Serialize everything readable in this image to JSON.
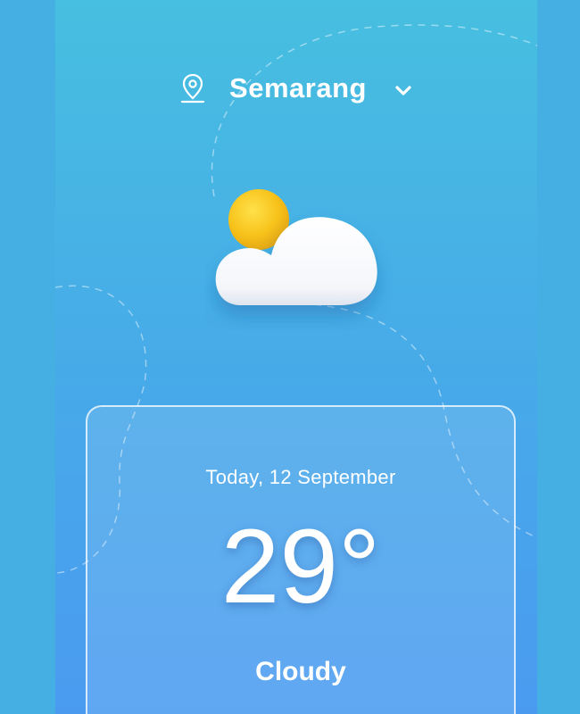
{
  "location": {
    "city": "Semarang"
  },
  "weather": {
    "icon": "sun-behind-cloud-icon",
    "date": "Today, 12 September",
    "temperature": "29°",
    "condition": "Cloudy"
  },
  "colors": {
    "background_top": "#47bfe0",
    "background_bottom": "#4a9bf0",
    "outer_background": "#45aee3",
    "sun": "#f7c21a",
    "cloud": "#ffffff",
    "text": "#ffffff"
  },
  "icons": {
    "pin": "location-pin-icon",
    "dropdown": "chevron-down-icon"
  }
}
